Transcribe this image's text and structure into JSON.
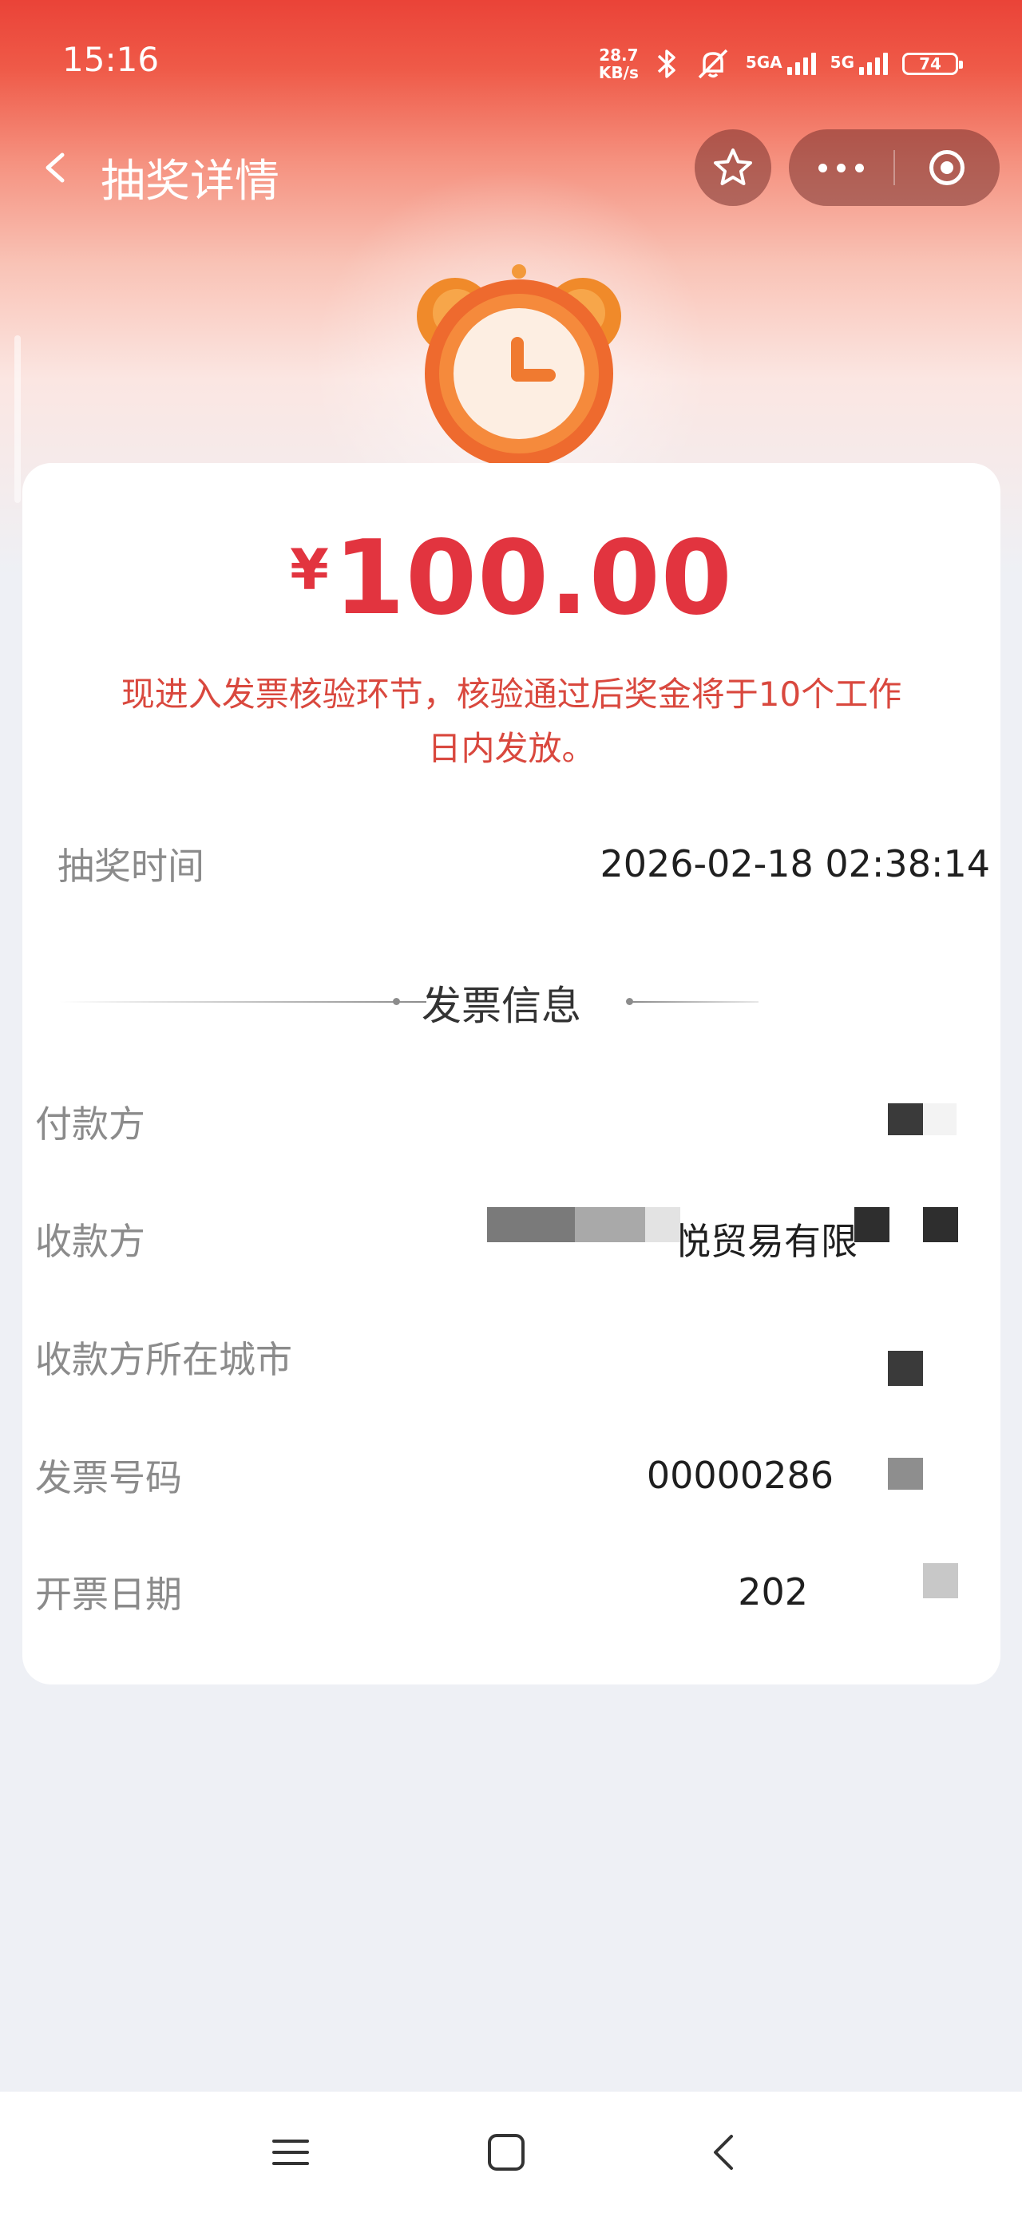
{
  "status": {
    "time": "15:16",
    "net_speed_value": "28.7",
    "net_speed_unit": "KB/s",
    "sim1_label": "5GA",
    "sim2_label": "5G",
    "battery": "74"
  },
  "nav": {
    "title": "抽奖详情"
  },
  "prize": {
    "currency": "¥",
    "amount": "100.00",
    "notice": "现进入发票核验环节，核验通过后奖金将于10个工作日内发放。"
  },
  "draw_time": {
    "label": "抽奖时间",
    "value": "2026-02-18 02:38:14"
  },
  "invoice_section_title": "发票信息",
  "invoice_rows": [
    {
      "label": "付款方",
      "value": ""
    },
    {
      "label": "收款方",
      "value": "悦贸易有限"
    },
    {
      "label": "收款方所在城市",
      "value": ""
    },
    {
      "label": "发票号码",
      "value": "00000286"
    },
    {
      "label": "开票日期",
      "value": "202"
    }
  ],
  "colors": {
    "accent_red": "#e2343f",
    "header_red": "#ea4338",
    "label_gray": "#8b8b8b"
  },
  "icons": [
    "chevron-left-icon",
    "star-icon",
    "more-dots-icon",
    "target-icon",
    "alarm-clock-icon",
    "menu-lines-icon",
    "home-square-icon",
    "back-triangle-icon"
  ]
}
